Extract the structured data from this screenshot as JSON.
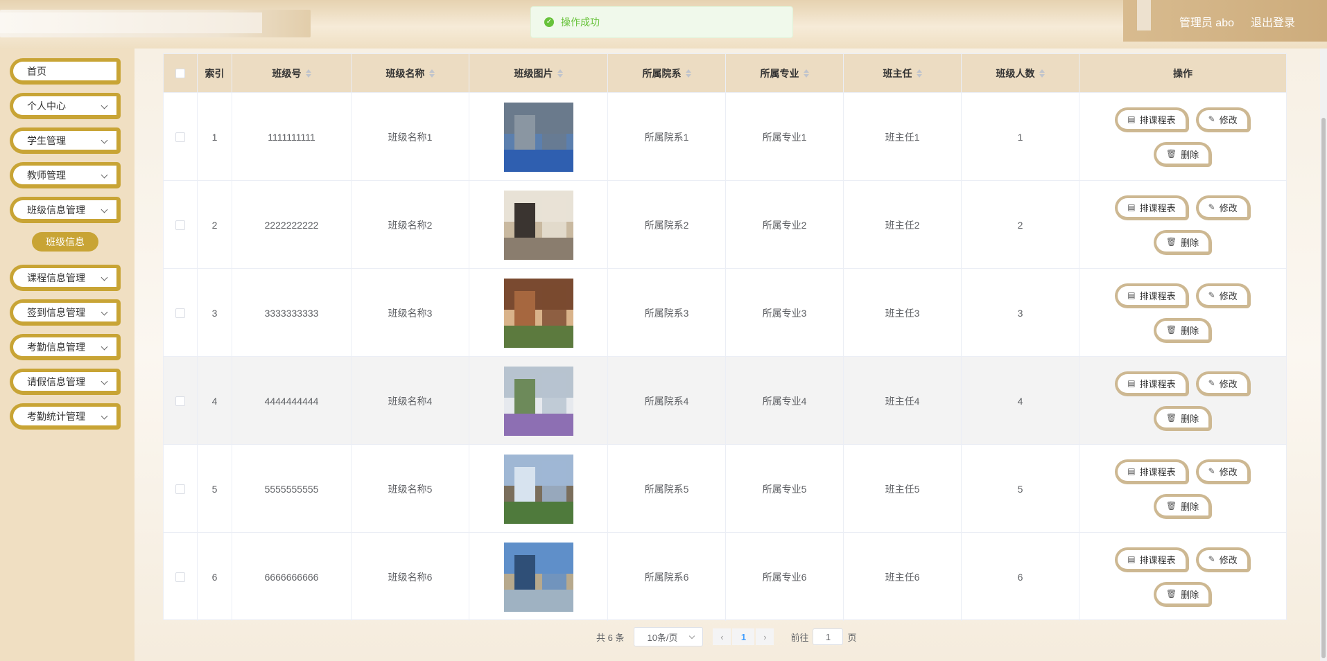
{
  "header": {
    "user_label": "管理员 abo",
    "logout_label": "退出登录"
  },
  "toast": {
    "message": "操作成功",
    "color": "#67c23a"
  },
  "sidebar": {
    "accent": "#c8a435",
    "items": [
      {
        "label": "首页"
      },
      {
        "label": "个人中心"
      },
      {
        "label": "学生管理"
      },
      {
        "label": "教师管理"
      },
      {
        "label": "班级信息管理"
      },
      {
        "label": "课程信息管理"
      },
      {
        "label": "签到信息管理"
      },
      {
        "label": "考勤信息管理"
      },
      {
        "label": "请假信息管理"
      },
      {
        "label": "考勤统计管理"
      }
    ],
    "active_sub": "班级信息"
  },
  "table": {
    "columns": [
      "索引",
      "班级号",
      "班级名称",
      "班级图片",
      "所属院系",
      "所属专业",
      "班主任",
      "班级人数",
      "操作"
    ],
    "rows": [
      {
        "index": "1",
        "class_no": "1111111111",
        "name": "班级名称1",
        "dept": "所属院系1",
        "major": "所属专业1",
        "teacher": "班主任1",
        "count": "1"
      },
      {
        "index": "2",
        "class_no": "2222222222",
        "name": "班级名称2",
        "dept": "所属院系2",
        "major": "所属专业2",
        "teacher": "班主任2",
        "count": "2"
      },
      {
        "index": "3",
        "class_no": "3333333333",
        "name": "班级名称3",
        "dept": "所属院系3",
        "major": "所属专业3",
        "teacher": "班主任3",
        "count": "3"
      },
      {
        "index": "4",
        "class_no": "4444444444",
        "name": "班级名称4",
        "dept": "所属院系4",
        "major": "所属专业4",
        "teacher": "班主任4",
        "count": "4"
      },
      {
        "index": "5",
        "class_no": "5555555555",
        "name": "班级名称5",
        "dept": "所属院系5",
        "major": "所属专业5",
        "teacher": "班主任5",
        "count": "5"
      },
      {
        "index": "6",
        "class_no": "6666666666",
        "name": "班级名称6",
        "dept": "所属院系6",
        "major": "所属专业6",
        "teacher": "班主任6",
        "count": "6"
      }
    ],
    "actions": {
      "schedule": "排课程表",
      "edit": "修改",
      "delete": "删除"
    }
  },
  "pagination": {
    "total_text": "共 6 条",
    "page_size": "10条/页",
    "current_page": "1",
    "goto_prefix": "前往",
    "goto_value": "1",
    "goto_suffix": "页"
  }
}
